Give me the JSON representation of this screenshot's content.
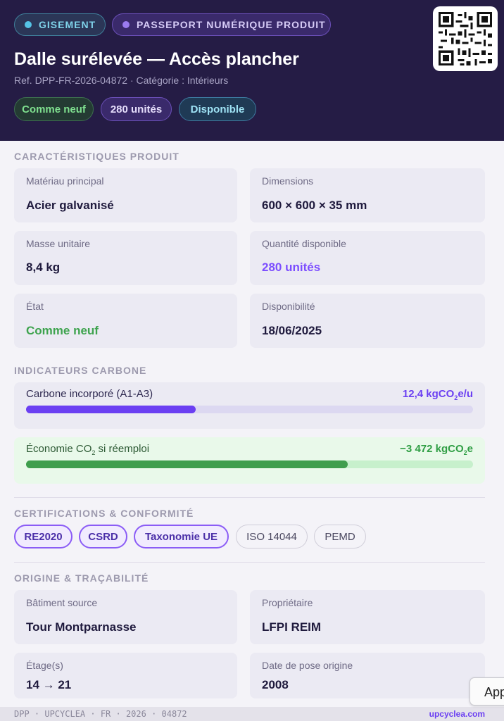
{
  "header": {
    "tag_gisement": "GISEMENT",
    "tag_passport": "PASSEPORT NUMÉRIQUE PRODUIT",
    "title": "Dalle surélevée — Accès plancher",
    "subtitle": "Ref. DPP-FR-2026-04872 · Catégorie : Intérieurs",
    "chips": {
      "condition": "Comme neuf",
      "quantity": "280 unités",
      "availability": "Disponible"
    },
    "qr_icon": "qr-code-icon"
  },
  "specs": {
    "title": "CARACTÉRISTIQUES PRODUIT",
    "cards": [
      {
        "label": "Matériau principal",
        "value": "Acier galvanisé"
      },
      {
        "label": "Dimensions",
        "value": "600 × 600 × 35 mm"
      },
      {
        "label": "Masse unitaire",
        "value": "8,4 kg"
      },
      {
        "label": "Quantité disponible",
        "value": "280 unités"
      },
      {
        "label": "État",
        "value": "Comme neuf"
      },
      {
        "label": "Disponibilité",
        "value": "18/06/2025"
      }
    ]
  },
  "carbon": {
    "title": "INDICATEURS CARBONE",
    "embodied": {
      "label_pre": "Carbone incorporé (A1-A3)",
      "value_pre": "12,4 kgCO",
      "value_sub": "2",
      "value_post": "e/u",
      "progress": 0.38
    },
    "savings": {
      "label_pre": "Économie CO",
      "label_sub": "2",
      "label_post": " si réemploi",
      "value_pre": "−3 472 kgCO",
      "value_sub": "2",
      "value_post": "e",
      "progress": 0.72
    },
    "accent_purple": "#6b3ff2",
    "accent_green": "#3f9e4d"
  },
  "certs": {
    "title": "CERTIFICATIONS & CONFORMITÉ",
    "items": [
      {
        "label": "RE2020",
        "active": true
      },
      {
        "label": "CSRD",
        "active": true
      },
      {
        "label": "Taxonomie UE",
        "active": true
      },
      {
        "label": "ISO 14044",
        "active": false
      },
      {
        "label": "PEMD",
        "active": false
      }
    ]
  },
  "origin": {
    "title": "ORIGINE & TRAÇABILITÉ",
    "cards": [
      {
        "label": "Bâtiment source",
        "value": "Tour Montparnasse"
      },
      {
        "label": "Propriétaire",
        "value": "LFPI REIM"
      },
      {
        "label": "Étage(s)",
        "value": "14 → 21"
      },
      {
        "label": "Date de pose origine",
        "value": "2008"
      }
    ]
  },
  "footer": {
    "code": "DPP · UPCYCLEA · FR · 2026 · 04872",
    "link": "upcyclea.com"
  },
  "overlay": {
    "app_button": "App"
  }
}
